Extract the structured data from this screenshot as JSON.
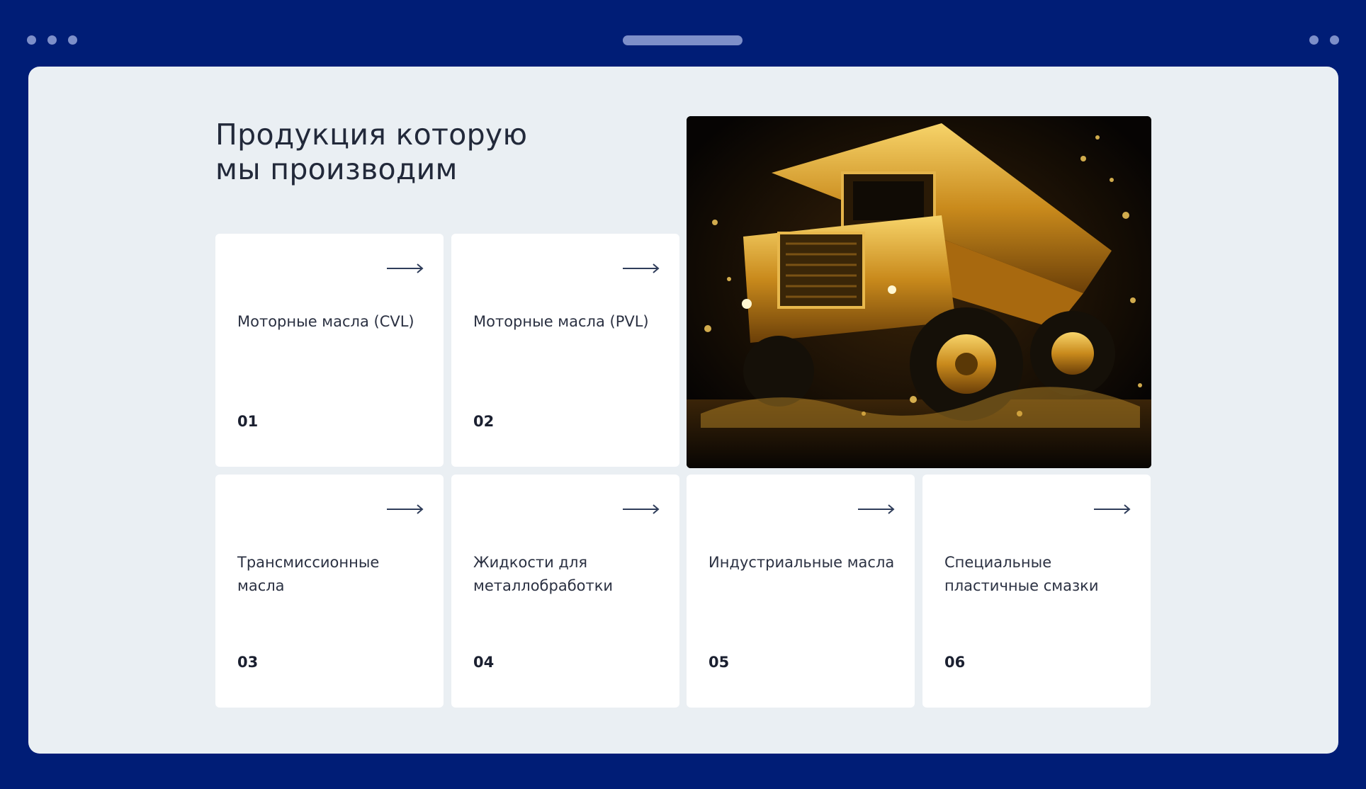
{
  "window": {
    "colors": {
      "frame": "#001d76",
      "viewport": "#eaeff3",
      "card": "#ffffff"
    }
  },
  "section": {
    "title_line1": "Продукция которую",
    "title_line2": "мы производим"
  },
  "products": [
    {
      "label": "Моторные масла (CVL)",
      "number": "01",
      "icon": "arrow-right-icon"
    },
    {
      "label": "Моторные масла (PVL)",
      "number": "02",
      "icon": "arrow-right-icon"
    },
    {
      "label": "Трансмиссионные масла",
      "number": "03",
      "icon": "arrow-right-icon"
    },
    {
      "label": "Жидкости для металлобработки",
      "number": "04",
      "icon": "arrow-right-icon"
    },
    {
      "label": "Индустриальные масла",
      "number": "05",
      "icon": "arrow-right-icon"
    },
    {
      "label": "Специальные пластичные смазки",
      "number": "06",
      "icon": "arrow-right-icon"
    }
  ],
  "hero_image": {
    "subject": "golden mining dump truck splashing through oil"
  }
}
